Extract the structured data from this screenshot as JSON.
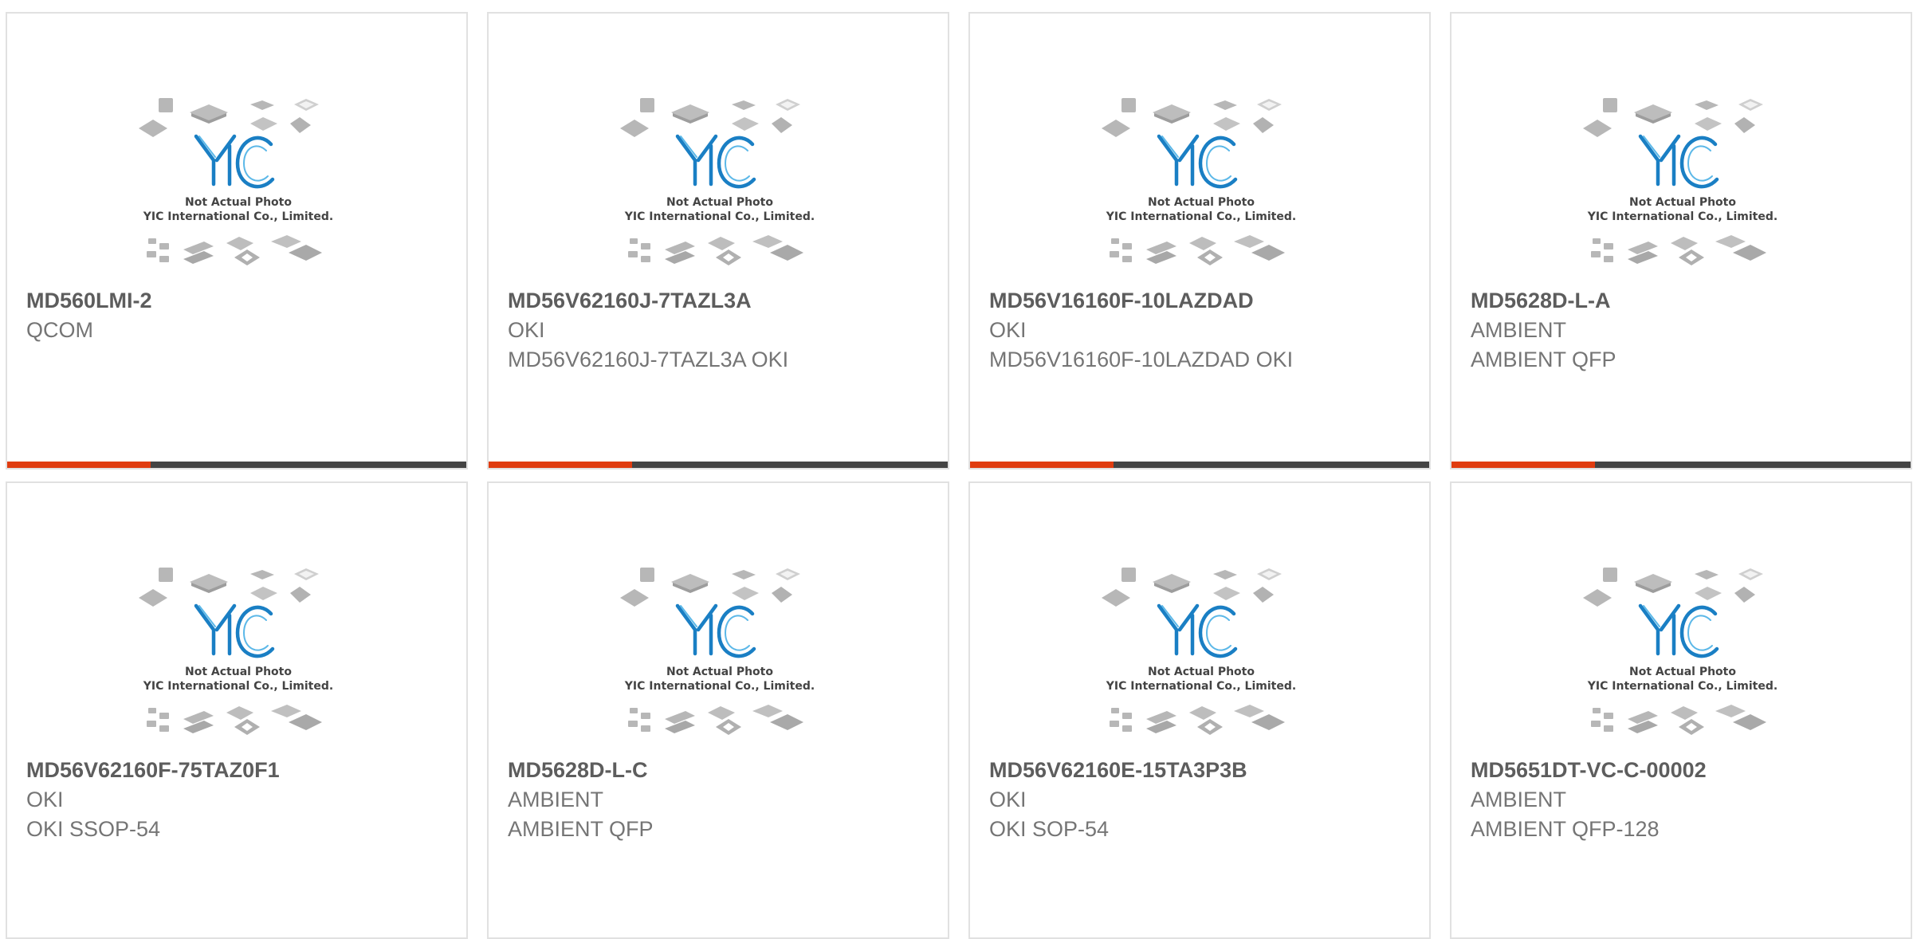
{
  "image_overlay": {
    "line1": "Not Actual Photo",
    "line2": "YIC International Co., Limited."
  },
  "colors": {
    "accent_bar": "#e03c10",
    "dark_bar": "#444444",
    "logo_blue": "#1a7fc4",
    "chip_gray": "#b5b5b5"
  },
  "products": [
    {
      "part": "MD560LMI-2",
      "brand": "QCOM",
      "desc": ""
    },
    {
      "part": "MD56V62160J-7TAZL3A",
      "brand": "OKI",
      "desc": "MD56V62160J-7TAZL3A OKI"
    },
    {
      "part": "MD56V16160F-10LAZDAD",
      "brand": "OKI",
      "desc": "MD56V16160F-10LAZDAD OKI"
    },
    {
      "part": "MD5628D-L-A",
      "brand": "AMBIENT",
      "desc": "AMBIENT QFP"
    },
    {
      "part": "MD56V62160F-75TAZ0F1",
      "brand": "OKI",
      "desc": "OKI SSOP-54"
    },
    {
      "part": "MD5628D-L-C",
      "brand": "AMBIENT",
      "desc": "AMBIENT QFP"
    },
    {
      "part": "MD56V62160E-15TA3P3B",
      "brand": "OKI",
      "desc": "OKI SOP-54"
    },
    {
      "part": "MD5651DT-VC-C-00002",
      "brand": "AMBIENT",
      "desc": "AMBIENT QFP-128"
    }
  ]
}
